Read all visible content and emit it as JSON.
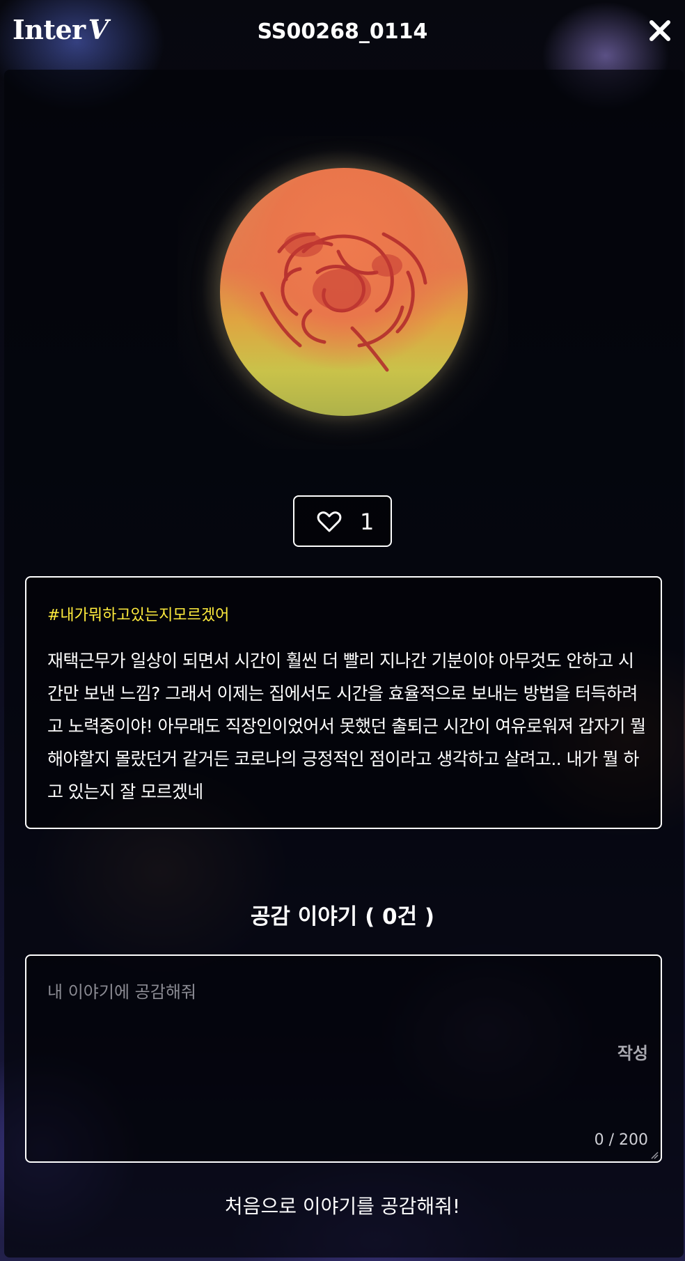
{
  "header": {
    "logo_main": "Inter",
    "logo_accent": "V",
    "title": "SS00268_0114",
    "close_icon": "close-icon"
  },
  "planet": {
    "image_icon": "planet-image"
  },
  "like": {
    "icon": "heart-icon",
    "count": "1"
  },
  "story": {
    "hashtag": "#내가뭐하고있는지모르겠어",
    "text": "재택근무가 일상이 되면서 시간이 훨씬 더 빨리 지나간 기분이야 아무것도 안하고 시간만 보낸 느낌? 그래서 이제는 집에서도 시간을 효율적으로 보내는 방법을 터득하려고 노력중이야! 아무래도 직장인이었어서 못했던 출퇴근 시간이 여유로워져 갑자기 뭘 해야할지 몰랐던거 같거든 코로나의 긍정적인 점이라고 생각하고 살려고.. 내가 뭘 하고 있는지 잘 모르겠네"
  },
  "comments": {
    "heading": "공감 이야기 ( 0건 )",
    "placeholder": "내 이야기에 공감해줘",
    "submit_label": "작성",
    "char_count": "0 / 200",
    "empty_message": "처음으로 이야기를 공감해줘!"
  },
  "colors": {
    "hashtag": "#ffec3d",
    "border": "#ffffff",
    "background": "#05060d"
  }
}
